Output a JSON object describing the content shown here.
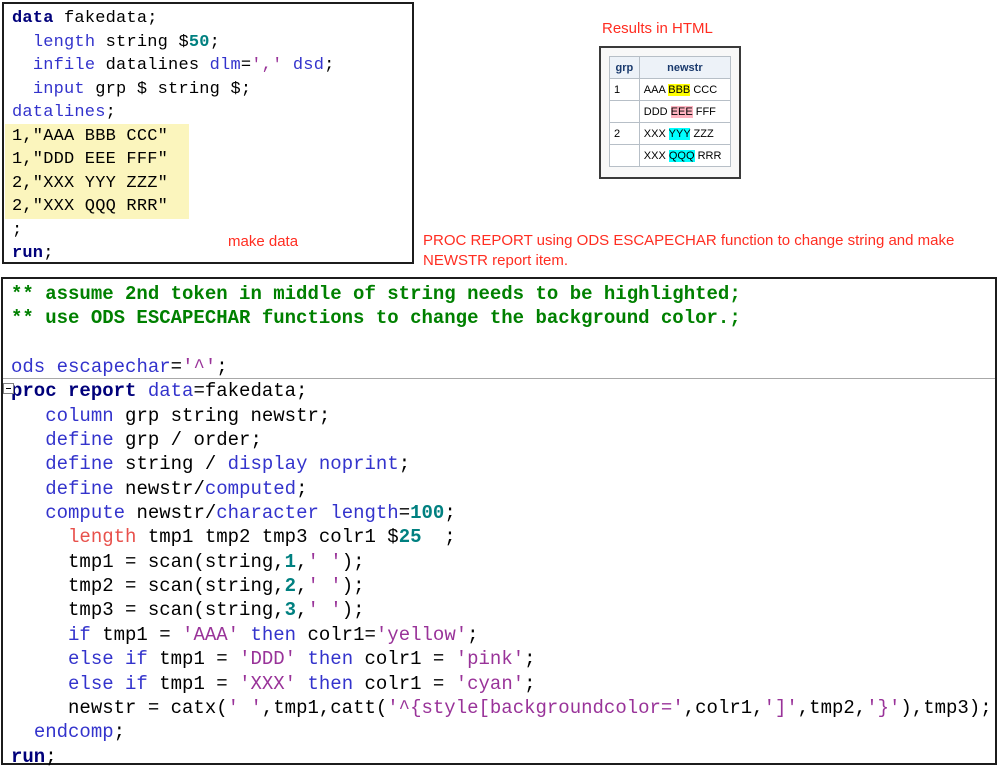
{
  "palette": {
    "navy": "#00007a",
    "keyword": "#3333cc",
    "string": "#993399",
    "number": "#008080",
    "comment": "#008000",
    "error_red": "#e8514c",
    "annotation_red": "#ff2d21",
    "datalines_bg": "#fbf5bd",
    "hl_yellow": "#ffff00",
    "hl_pink": "#ffb3c1",
    "hl_cyan": "#00ffff",
    "table_header_bg": "#edf2f8",
    "table_header_text": "#1a3a6d",
    "table_border": "#b7bfc7"
  },
  "top_code": {
    "annotation": "make data",
    "lines": [
      [
        {
          "c": "navy",
          "t": "data"
        },
        {
          "c": "base",
          "t": " fakedata;"
        }
      ],
      [
        {
          "c": "base",
          "t": "  "
        },
        {
          "c": "kw",
          "t": "length"
        },
        {
          "c": "base",
          "t": " string $"
        },
        {
          "c": "num",
          "t": "50"
        },
        {
          "c": "base",
          "t": ";"
        }
      ],
      [
        {
          "c": "base",
          "t": "  "
        },
        {
          "c": "kw",
          "t": "infile"
        },
        {
          "c": "base",
          "t": " datalines "
        },
        {
          "c": "kw",
          "t": "dlm"
        },
        {
          "c": "base",
          "t": "="
        },
        {
          "c": "str",
          "t": "','"
        },
        {
          "c": "base",
          "t": " "
        },
        {
          "c": "kw",
          "t": "dsd"
        },
        {
          "c": "base",
          "t": ";"
        }
      ],
      [
        {
          "c": "base",
          "t": "  "
        },
        {
          "c": "kw",
          "t": "input"
        },
        {
          "c": "base",
          "t": " grp $ string $;"
        }
      ],
      [
        {
          "c": "kw",
          "t": "datalines"
        },
        {
          "c": "base",
          "t": ";"
        }
      ],
      [
        {
          "c": "base",
          "t": "1,\"AAA BBB CCC\""
        }
      ],
      [
        {
          "c": "base",
          "t": "1,\"DDD EEE FFF\""
        }
      ],
      [
        {
          "c": "base",
          "t": "2,\"XXX YYY ZZZ\""
        }
      ],
      [
        {
          "c": "base",
          "t": "2,\"XXX QQQ RRR\""
        }
      ],
      [
        {
          "c": "base",
          "t": ";"
        }
      ],
      [
        {
          "c": "navy",
          "t": "run"
        },
        {
          "c": "base",
          "t": ";"
        }
      ]
    ]
  },
  "results": {
    "title": "Results in HTML",
    "table": {
      "headers": [
        "grp",
        "newstr"
      ],
      "rows": [
        {
          "grp": "1",
          "parts": [
            {
              "t": "AAA "
            },
            {
              "t": "BBB",
              "hl": "yellow"
            },
            {
              "t": " CCC"
            }
          ]
        },
        {
          "grp": "",
          "parts": [
            {
              "t": "DDD "
            },
            {
              "t": "EEE",
              "hl": "pink"
            },
            {
              "t": " FFF"
            }
          ]
        },
        {
          "grp": "2",
          "parts": [
            {
              "t": "XXX "
            },
            {
              "t": "YYY",
              "hl": "cyan"
            },
            {
              "t": " ZZZ"
            }
          ]
        },
        {
          "grp": "",
          "parts": [
            {
              "t": "XXX "
            },
            {
              "t": "QQQ",
              "hl": "cyan"
            },
            {
              "t": " RRR"
            }
          ]
        }
      ]
    }
  },
  "caption": {
    "line1": "PROC REPORT using ODS ESCAPECHAR function to change string and make",
    "line2": "NEWSTR report item."
  },
  "bottom_code": {
    "lines": [
      [
        {
          "c": "cmt",
          "t": "** assume 2nd token in middle of string needs to be highlighted;"
        }
      ],
      [
        {
          "c": "cmt",
          "t": "** use ODS ESCAPECHAR functions to change the background color.;"
        }
      ],
      [],
      [
        {
          "c": "kw",
          "t": "ods"
        },
        {
          "c": "base",
          "t": " "
        },
        {
          "c": "kw",
          "t": "escapechar"
        },
        {
          "c": "base",
          "t": "="
        },
        {
          "c": "str",
          "t": "'^'"
        },
        {
          "c": "base",
          "t": ";"
        }
      ],
      [
        {
          "c": "navy",
          "t": "proc report"
        },
        {
          "c": "base",
          "t": " "
        },
        {
          "c": "kw",
          "t": "data"
        },
        {
          "c": "base",
          "t": "=fakedata;"
        }
      ],
      [
        {
          "c": "base",
          "t": "   "
        },
        {
          "c": "kw",
          "t": "column"
        },
        {
          "c": "base",
          "t": " grp string newstr;"
        }
      ],
      [
        {
          "c": "base",
          "t": "   "
        },
        {
          "c": "kw",
          "t": "define"
        },
        {
          "c": "base",
          "t": " grp / order;"
        }
      ],
      [
        {
          "c": "base",
          "t": "   "
        },
        {
          "c": "kw",
          "t": "define"
        },
        {
          "c": "base",
          "t": " string / "
        },
        {
          "c": "kw",
          "t": "display"
        },
        {
          "c": "base",
          "t": " "
        },
        {
          "c": "kw",
          "t": "noprint"
        },
        {
          "c": "base",
          "t": ";"
        }
      ],
      [
        {
          "c": "base",
          "t": "   "
        },
        {
          "c": "kw",
          "t": "define"
        },
        {
          "c": "base",
          "t": " newstr/"
        },
        {
          "c": "kw",
          "t": "computed"
        },
        {
          "c": "base",
          "t": ";"
        }
      ],
      [
        {
          "c": "base",
          "t": "   "
        },
        {
          "c": "kw",
          "t": "compute"
        },
        {
          "c": "base",
          "t": " newstr/"
        },
        {
          "c": "kw",
          "t": "character"
        },
        {
          "c": "base",
          "t": " "
        },
        {
          "c": "kw",
          "t": "length"
        },
        {
          "c": "base",
          "t": "="
        },
        {
          "c": "num",
          "t": "100"
        },
        {
          "c": "base",
          "t": ";"
        }
      ],
      [
        {
          "c": "base",
          "t": "     "
        },
        {
          "c": "red",
          "t": "length"
        },
        {
          "c": "base",
          "t": " tmp1 tmp2 tmp3 colr1 $"
        },
        {
          "c": "num",
          "t": "25"
        },
        {
          "c": "base",
          "t": "  ;"
        }
      ],
      [
        {
          "c": "base",
          "t": "     tmp1 = scan(string,"
        },
        {
          "c": "num",
          "t": "1"
        },
        {
          "c": "base",
          "t": ","
        },
        {
          "c": "str",
          "t": "' '"
        },
        {
          "c": "base",
          "t": ");"
        }
      ],
      [
        {
          "c": "base",
          "t": "     tmp2 = scan(string,"
        },
        {
          "c": "num",
          "t": "2"
        },
        {
          "c": "base",
          "t": ","
        },
        {
          "c": "str",
          "t": "' '"
        },
        {
          "c": "base",
          "t": ");"
        }
      ],
      [
        {
          "c": "base",
          "t": "     tmp3 = scan(string,"
        },
        {
          "c": "num",
          "t": "3"
        },
        {
          "c": "base",
          "t": ","
        },
        {
          "c": "str",
          "t": "' '"
        },
        {
          "c": "base",
          "t": ");"
        }
      ],
      [
        {
          "c": "base",
          "t": "     "
        },
        {
          "c": "kw",
          "t": "if"
        },
        {
          "c": "base",
          "t": " tmp1 = "
        },
        {
          "c": "str",
          "t": "'AAA'"
        },
        {
          "c": "base",
          "t": " "
        },
        {
          "c": "kw",
          "t": "then"
        },
        {
          "c": "base",
          "t": " colr1="
        },
        {
          "c": "str",
          "t": "'yellow'"
        },
        {
          "c": "base",
          "t": ";"
        }
      ],
      [
        {
          "c": "base",
          "t": "     "
        },
        {
          "c": "kw",
          "t": "else"
        },
        {
          "c": "base",
          "t": " "
        },
        {
          "c": "kw",
          "t": "if"
        },
        {
          "c": "base",
          "t": " tmp1 = "
        },
        {
          "c": "str",
          "t": "'DDD'"
        },
        {
          "c": "base",
          "t": " "
        },
        {
          "c": "kw",
          "t": "then"
        },
        {
          "c": "base",
          "t": " colr1 = "
        },
        {
          "c": "str",
          "t": "'pink'"
        },
        {
          "c": "base",
          "t": ";"
        }
      ],
      [
        {
          "c": "base",
          "t": "     "
        },
        {
          "c": "kw",
          "t": "else"
        },
        {
          "c": "base",
          "t": " "
        },
        {
          "c": "kw",
          "t": "if"
        },
        {
          "c": "base",
          "t": " tmp1 = "
        },
        {
          "c": "str",
          "t": "'XXX'"
        },
        {
          "c": "base",
          "t": " "
        },
        {
          "c": "kw",
          "t": "then"
        },
        {
          "c": "base",
          "t": " colr1 = "
        },
        {
          "c": "str",
          "t": "'cyan'"
        },
        {
          "c": "base",
          "t": ";"
        }
      ],
      [
        {
          "c": "base",
          "t": "     newstr = catx("
        },
        {
          "c": "str",
          "t": "' '"
        },
        {
          "c": "base",
          "t": ",tmp1,catt("
        },
        {
          "c": "str",
          "t": "'^{style[backgroundcolor='"
        },
        {
          "c": "base",
          "t": ",colr1,"
        },
        {
          "c": "str",
          "t": "']'"
        },
        {
          "c": "base",
          "t": ",tmp2,"
        },
        {
          "c": "str",
          "t": "'}'"
        },
        {
          "c": "base",
          "t": "),tmp3);"
        }
      ],
      [
        {
          "c": "base",
          "t": "  "
        },
        {
          "c": "kw",
          "t": "endcomp"
        },
        {
          "c": "base",
          "t": ";"
        }
      ],
      [
        {
          "c": "navy",
          "t": "run"
        },
        {
          "c": "base",
          "t": ";"
        }
      ]
    ]
  }
}
